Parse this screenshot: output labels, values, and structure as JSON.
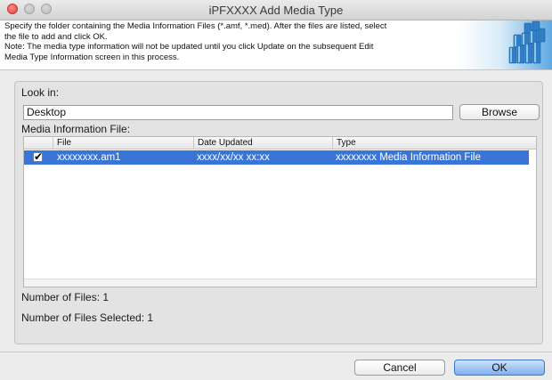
{
  "window": {
    "title": "iPFXXXX Add Media Type"
  },
  "header": {
    "lines": [
      "Specify the folder containing the Media Information Files (*.amf, *.med). After the files are listed, select",
      "the file to add and click OK.",
      "Note: The media type information will not be updated until you click Update on the subsequent Edit",
      "Media Type Information screen in this process."
    ]
  },
  "look_in": {
    "label": "Look in:",
    "value": "Desktop",
    "browse_label": "Browse"
  },
  "media_list": {
    "label": "Media Information File:",
    "columns": [
      "File",
      "Date Updated",
      "Type"
    ],
    "rows": [
      {
        "checked": true,
        "check_glyph": "✔",
        "file": "xxxxxxxx.am1",
        "date": "xxxx/xx/xx xx:xx",
        "type": "xxxxxxxx Media Information File"
      }
    ]
  },
  "summary": {
    "number_of_files": "Number of Files: 1",
    "number_selected": "Number of Files Selected: 1"
  },
  "buttons": {
    "cancel": "Cancel",
    "ok": "OK"
  },
  "colors": {
    "selection": "#3875d7",
    "close_button": "#e0443e",
    "default_button": "#7fb0ef"
  },
  "icons": {
    "banner": "stacked-media-rolls-banner",
    "checkbox": "checkmark-icon"
  }
}
